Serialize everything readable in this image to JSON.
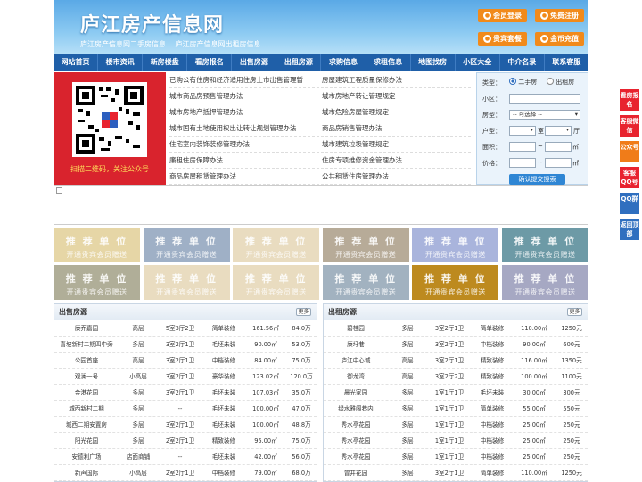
{
  "site": {
    "title": "庐江房产信息网",
    "slogan": [
      "庐江房产信息网二手房信息",
      "庐江房产信息网出租房信息"
    ]
  },
  "header_buttons": [
    {
      "label": "会员登录",
      "icon": "user-icon"
    },
    {
      "label": "免费注册",
      "icon": "register-icon"
    },
    {
      "label": "贵宾套餐",
      "icon": "vip-icon"
    },
    {
      "label": "金币充值",
      "icon": "coin-icon"
    }
  ],
  "nav": [
    "网站首页",
    "楼市资讯",
    "新房楼盘",
    "看房报名",
    "出售房源",
    "出租房源",
    "求购信息",
    "求租信息",
    "地图找房",
    "小区大全",
    "中介名录",
    "联系客服"
  ],
  "qr": {
    "caption": "扫描二维码，关注公众号"
  },
  "news": [
    [
      "已购公有住房和经济适用住房上市出售管理暂",
      "房屋建筑工程质量保修办法"
    ],
    [
      "城市商品房预售管理办法",
      "城市房地产转让管理规定"
    ],
    [
      "城市房地产抵押管理办法",
      "城市危险房屋管理规定"
    ],
    [
      "城市国有土地使用权出让转让规划管理办法",
      "商品房销售管理办法"
    ],
    [
      "住宅室内装饰装修管理办法",
      "城市建筑垃圾管理规定"
    ],
    [
      "廉租住房保障办法",
      "住房专项维修资金管理办法"
    ],
    [
      "商品房屋租赁管理办法",
      "公共租赁住房管理办法"
    ]
  ],
  "search": {
    "type_label": "类型：",
    "opt_second": "二手房",
    "opt_rent": "出租房",
    "community_label": "小区：",
    "house_type_label": "房型：",
    "select_placeholder": "-- 可选择 --",
    "layout_label": "户型：",
    "room_unit": "室",
    "hall_unit": "厅",
    "area_label": "面积：",
    "area_unit": "㎡",
    "price_label": "价格：",
    "price_unit": "㎡",
    "range_sep": "~",
    "submit": "确认提交搜索"
  },
  "tiles": {
    "title": "推 荐 单 位",
    "subtitle": "开通贵宾会员赠送",
    "colors": [
      "#e6d6a6",
      "#9fb0c6",
      "#e9dcc0",
      "#b7ab98",
      "#a9b4dc",
      "#6d9aa6",
      "#b0ae98",
      "#e9dcc0",
      "#e9dcc0",
      "#a2b2c0",
      "#bd8a1f",
      "#a6a8c3"
    ]
  },
  "sale": {
    "title": "出售房源",
    "more": "更多",
    "rows": [
      [
        "康乔嘉园",
        "高层",
        "5室3厅2卫",
        "简单装修",
        "161.56㎡",
        "84.0万"
      ],
      [
        "喜坡新村二期四中旁",
        "多层",
        "3室2厅1卫",
        "毛坯未装",
        "90.00㎡",
        "53.0万"
      ],
      [
        "公园首座",
        "高层",
        "3室2厅1卫",
        "中档装修",
        "84.00㎡",
        "75.0万"
      ],
      [
        "观澜一号",
        "小高层",
        "3室2厅1卫",
        "豪华装修",
        "123.02㎡",
        "120.0万"
      ],
      [
        "金港花园",
        "多层",
        "3室2厅1卫",
        "毛坯未装",
        "107.03㎡",
        "35.0万"
      ],
      [
        "城西新村二期",
        "多层",
        "--",
        "毛坯未装",
        "100.00㎡",
        "47.0万"
      ],
      [
        "城西二期安置房",
        "多层",
        "3室2厅1卫",
        "毛坯未装",
        "100.00㎡",
        "48.8万"
      ],
      [
        "阳光花园",
        "多层",
        "2室2厅1卫",
        "精致装修",
        "95.00㎡",
        "75.0万"
      ],
      [
        "安德利广场",
        "店面商铺",
        "--",
        "毛坯未装",
        "42.00㎡",
        "56.0万"
      ],
      [
        "新声国际",
        "小高层",
        "2室2厅1卫",
        "中档装修",
        "79.00㎡",
        "68.0万"
      ]
    ]
  },
  "rent": {
    "title": "出租房源",
    "more": "更多",
    "rows": [
      [
        "碧桂园",
        "多层",
        "3室2厅1卫",
        "简单装修",
        "110.00㎡",
        "1250元"
      ],
      [
        "康圩巷",
        "多层",
        "3室2厅1卫",
        "中档装修",
        "90.00㎡",
        "600元"
      ],
      [
        "庐江中心城",
        "高层",
        "3室2厅1卫",
        "精致装修",
        "116.00㎡",
        "1350元"
      ],
      [
        "御龙湾",
        "高层",
        "3室2厅2卫",
        "精致装修",
        "100.00㎡",
        "1100元"
      ],
      [
        "晨光家园",
        "多层",
        "1室1厅1卫",
        "毛坯未装",
        "30.00㎡",
        "300元"
      ],
      [
        "绿水雅阁巷内",
        "多层",
        "1室1厅1卫",
        "简单装修",
        "55.00㎡",
        "550元"
      ],
      [
        "秀水亭花园",
        "多层",
        "1室1厅1卫",
        "中档装修",
        "25.00㎡",
        "250元"
      ],
      [
        "秀水亭花园",
        "多层",
        "1室1厅1卫",
        "中档装修",
        "25.00㎡",
        "250元"
      ],
      [
        "秀水亭花园",
        "多层",
        "1室1厅1卫",
        "中档装修",
        "25.00㎡",
        "250元"
      ],
      [
        "曾井花园",
        "多层",
        "3室2厅1卫",
        "简单装修",
        "110.00㎡",
        "1250元"
      ]
    ]
  },
  "side": [
    {
      "label": "看房报名",
      "color": "#e8232f"
    },
    {
      "label": "客服微信",
      "color": "#e8232f"
    },
    {
      "label": "公众号",
      "color": "#f07c19"
    },
    {
      "label": "客服QQ号",
      "color": "#e8232f"
    },
    {
      "label": "QQ群",
      "color": "#2f6fbf"
    },
    {
      "label": "返回顶部",
      "color": "#2f6fbf"
    }
  ]
}
